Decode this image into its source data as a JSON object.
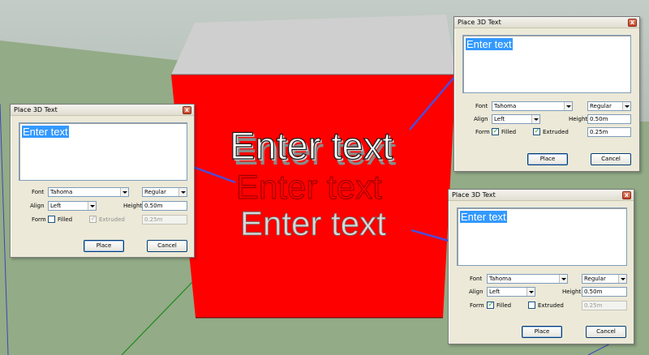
{
  "dialog": {
    "title": "Place 3D Text",
    "text_value": "Enter text",
    "font_label": "Font",
    "align_label": "Align",
    "height_label": "Height",
    "form_label": "Form",
    "filled_label": "Filled",
    "extruded_label": "Extruded",
    "place_label": "Place",
    "cancel_label": "Cancel",
    "close_glyph": "x"
  },
  "dialogs": [
    {
      "font": "Tahoma",
      "style": "Regular",
      "align": "Left",
      "height": "0.50m",
      "extrude": "0.25m",
      "filled": false,
      "extruded": true,
      "extrude_enabled": false
    },
    {
      "font": "Tahoma",
      "style": "Regular",
      "align": "Left",
      "height": "0.50m",
      "extrude": "0.25m",
      "filled": true,
      "extruded": true,
      "extrude_enabled": true
    },
    {
      "font": "Tahoma",
      "style": "Regular",
      "align": "Left",
      "height": "0.50m",
      "extrude": "0.25m",
      "filled": true,
      "extruded": false,
      "extrude_enabled": false
    }
  ],
  "scene": {
    "text_extruded": "Enter text",
    "text_outline": "Enter text",
    "text_filled": "Enter text",
    "colors": {
      "ground": "#93ab87",
      "sky": "#bac5be",
      "cube_front": "#ff0000",
      "cube_top": "#cfcfcf"
    }
  },
  "icons": {
    "check": "check-icon",
    "close": "close-icon",
    "dropdown": "chevron-down-icon"
  },
  "check_glyph": "✓"
}
